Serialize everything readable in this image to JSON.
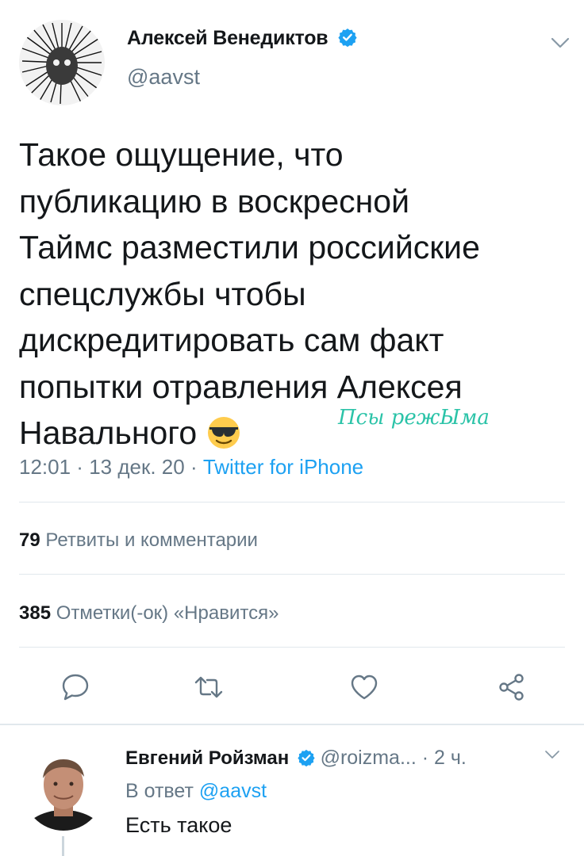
{
  "tweet": {
    "author_name": "Алексей Венедиктов",
    "handle": "@aavst",
    "text": "Такое ощущение, что\nпубликацию в  воскресной\nТаймс разместили российские\nспецслужбы чтобы\nдискредитировать сам факт\nпопытки отравления Алексея\nНавального",
    "emoji": "smiling-face-with-sunglasses",
    "time": "12:01",
    "date": "13 дек. 20",
    "separator": " · ",
    "source": "Twitter for iPhone",
    "retweets_count": "79",
    "retweets_label": "Ретвиты и комментарии",
    "likes_count": "385",
    "likes_label": "Отметки(-ок) «Нравится»"
  },
  "watermark": "Псы режЫма",
  "reply": {
    "author_name": "Евгений Ройзман",
    "meta": "@roizma... · 2 ч.",
    "in_reply_prefix": "В ответ",
    "in_reply_handle": "@aavst",
    "text": "Есть такое"
  },
  "colors": {
    "link": "#1da1f2",
    "muted": "#657786",
    "divider": "#e1e8ed",
    "watermark": "#2bc3a8"
  }
}
